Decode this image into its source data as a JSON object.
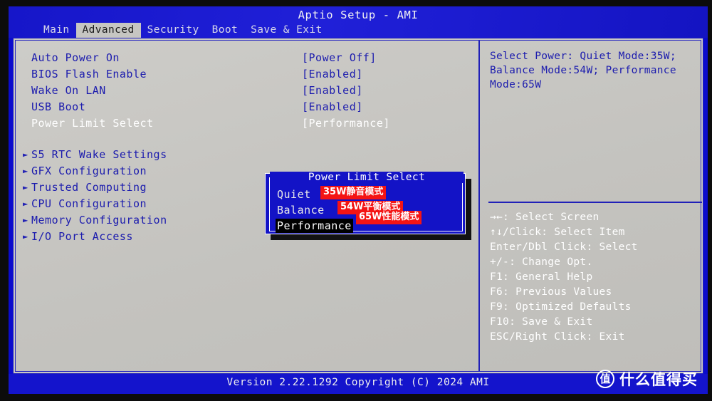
{
  "window": {
    "title": "Aptio Setup - AMI"
  },
  "tabs": [
    {
      "label": "Main",
      "active": false
    },
    {
      "label": "Advanced",
      "active": true
    },
    {
      "label": "Security",
      "active": false
    },
    {
      "label": "Boot",
      "active": false
    },
    {
      "label": "Save & Exit",
      "active": false
    }
  ],
  "settings": [
    {
      "label": "Auto Power On",
      "value": "[Power Off]",
      "submenu": false,
      "selected": false
    },
    {
      "label": "BIOS Flash Enable",
      "value": "[Enabled]",
      "submenu": false,
      "selected": false
    },
    {
      "label": "Wake On LAN",
      "value": "[Enabled]",
      "submenu": false,
      "selected": false
    },
    {
      "label": "USB Boot",
      "value": "[Enabled]",
      "submenu": false,
      "selected": false
    },
    {
      "label": "Power Limit Select",
      "value": "[Performance]",
      "submenu": false,
      "selected": true
    },
    {
      "label": "S5 RTC Wake Settings",
      "value": "",
      "submenu": true,
      "selected": false
    },
    {
      "label": "GFX Configuration",
      "value": "",
      "submenu": true,
      "selected": false
    },
    {
      "label": "Trusted Computing",
      "value": "",
      "submenu": true,
      "selected": false
    },
    {
      "label": "CPU Configuration",
      "value": "",
      "submenu": true,
      "selected": false
    },
    {
      "label": "Memory Configuration",
      "value": "",
      "submenu": true,
      "selected": false
    },
    {
      "label": "I/O Port Access",
      "value": "",
      "submenu": true,
      "selected": false
    }
  ],
  "help": {
    "text": "Select Power: Quiet Mode:35W; Balance Mode:54W; Performance Mode:65W"
  },
  "keys": [
    "→←: Select Screen",
    "↑↓/Click: Select Item",
    "Enter/Dbl Click: Select",
    "+/-: Change Opt.",
    "F1: General Help",
    "F6: Previous Values",
    "F9: Optimized Defaults",
    "F10: Save & Exit",
    "ESC/Right Click: Exit"
  ],
  "dialog": {
    "title": "Power Limit Select",
    "options": [
      {
        "name": "Quiet",
        "selected": false
      },
      {
        "name": "Balance",
        "selected": false
      },
      {
        "name": "Performance",
        "selected": true
      }
    ]
  },
  "annotations": [
    "35W静音模式",
    "54W平衡模式",
    "65W性能模式"
  ],
  "footer": {
    "text": "Version 2.22.1292 Copyright (C) 2024 AMI"
  },
  "watermark": {
    "logo": "值",
    "text": "什么值得买"
  },
  "colors": {
    "bios_blue": "#1313c6",
    "panel_gray": "#c9c8c4",
    "label_blue": "#1c1cae",
    "annotation_red": "#f41414",
    "selected_white": "#ffffff"
  }
}
